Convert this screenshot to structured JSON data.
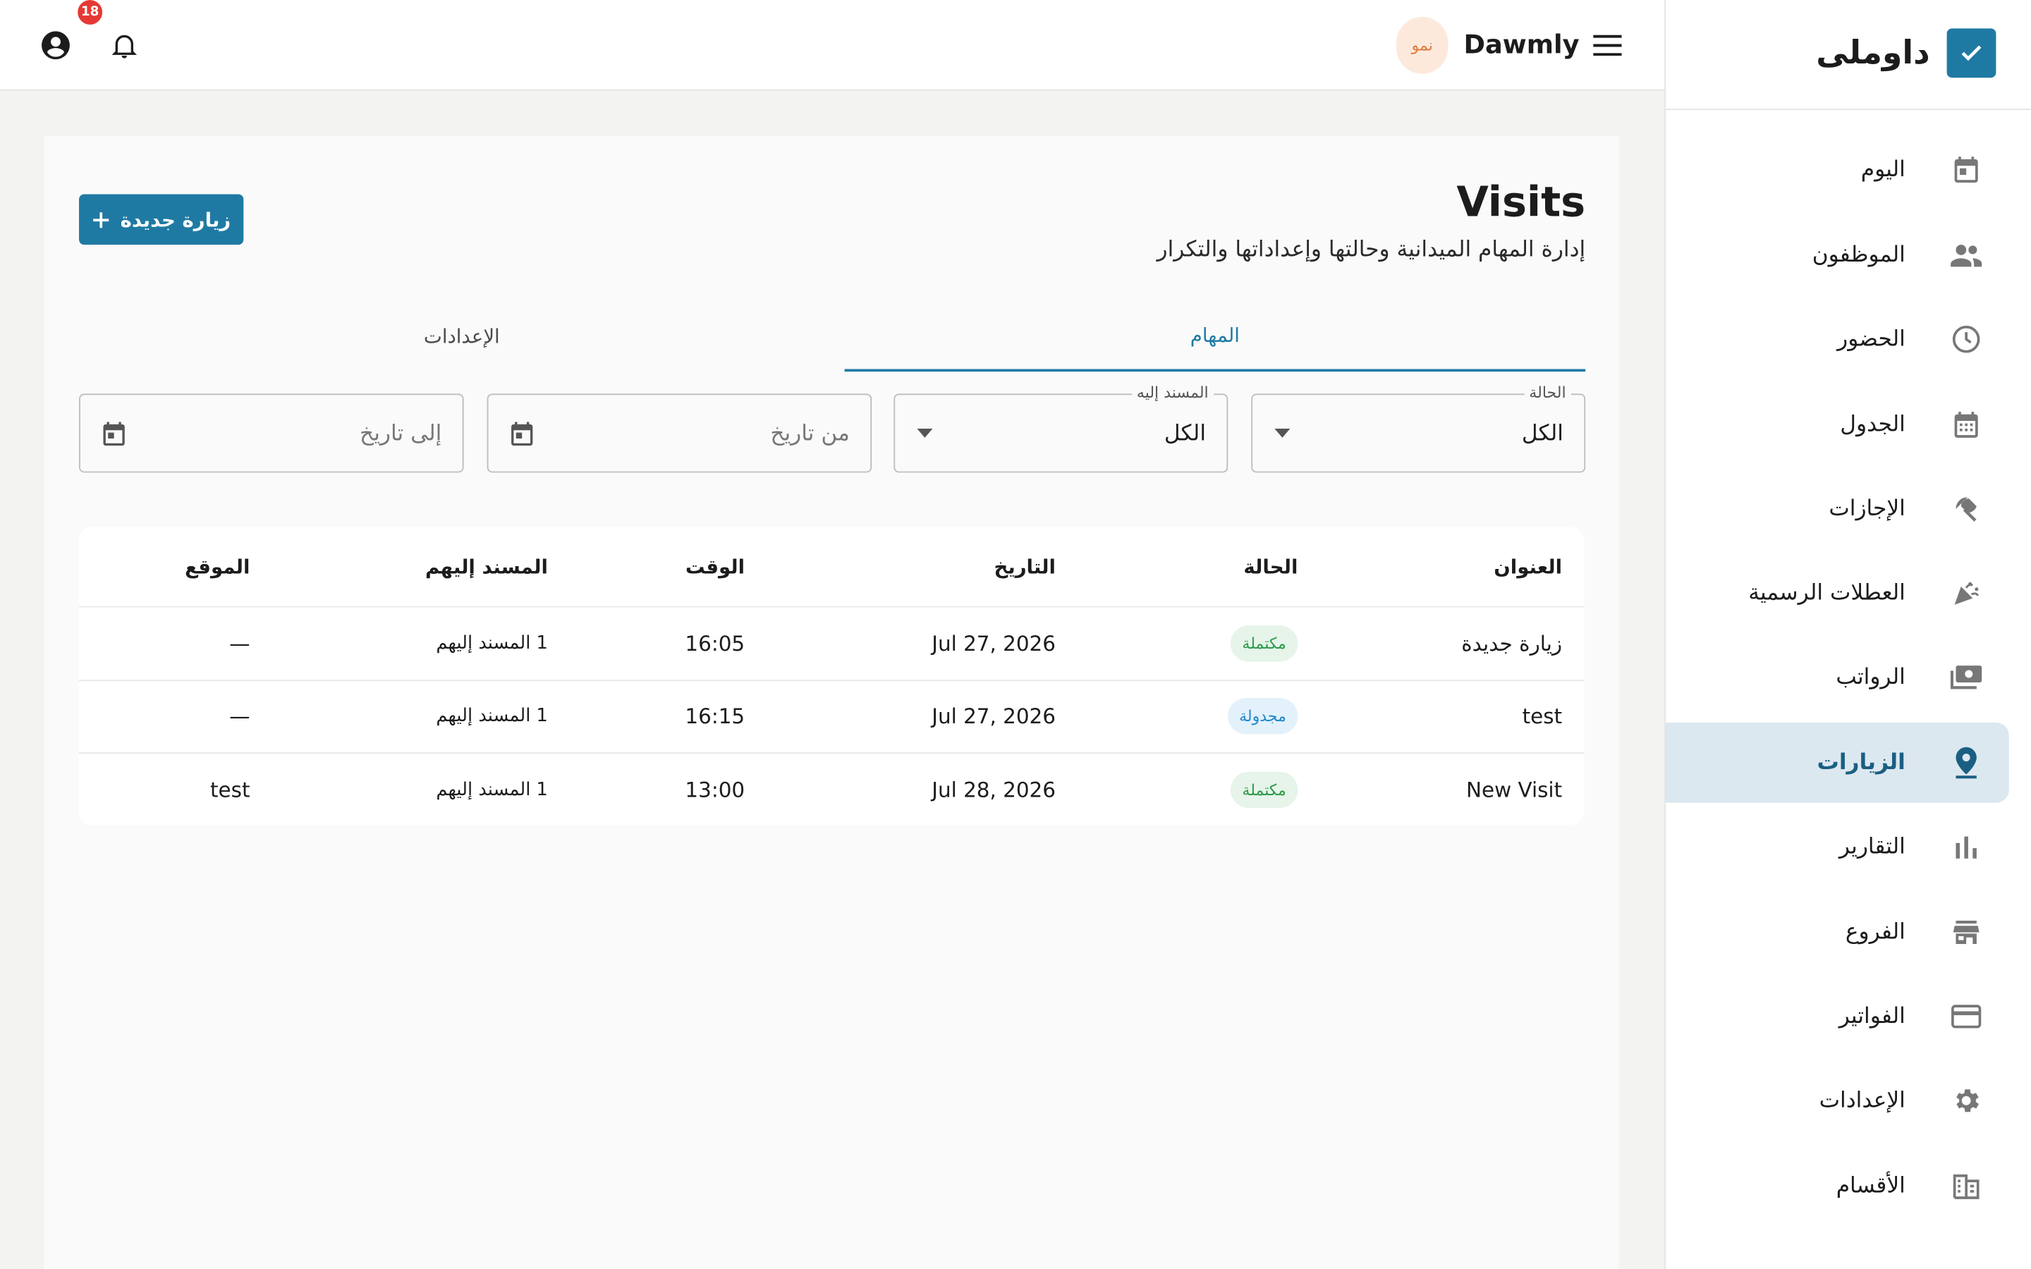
{
  "topbar": {
    "notification_count": "18",
    "brand_name": "Dawmly",
    "brand_chip": "نمو"
  },
  "sidebar": {
    "logo_text": "داوملى",
    "items": [
      {
        "label": "اليوم",
        "icon": "calendar-today-icon"
      },
      {
        "label": "الموظفون",
        "icon": "people-icon"
      },
      {
        "label": "الحضور",
        "icon": "clock-icon"
      },
      {
        "label": "الجدول",
        "icon": "calendar-grid-icon"
      },
      {
        "label": "الإجازات",
        "icon": "beach-umbrella-icon"
      },
      {
        "label": "العطلات الرسمية",
        "icon": "celebration-icon"
      },
      {
        "label": "الرواتب",
        "icon": "payments-icon"
      },
      {
        "label": "الزيارات",
        "icon": "location-pin-icon",
        "active": true
      },
      {
        "label": "التقارير",
        "icon": "bar-chart-icon"
      },
      {
        "label": "الفروع",
        "icon": "store-icon"
      },
      {
        "label": "الفواتير",
        "icon": "credit-card-icon"
      },
      {
        "label": "الإعدادات",
        "icon": "gear-icon"
      },
      {
        "label": "الأقسام",
        "icon": "building-icon"
      }
    ]
  },
  "main": {
    "title": "Visits",
    "subtitle": "إدارة المهام الميدانية وحالتها وإعداداتها والتكرار",
    "new_button_label": "زيارة جديدة",
    "tabs": [
      {
        "label": "المهام",
        "active": true
      },
      {
        "label": "الإعدادات",
        "active": false
      }
    ],
    "filters": {
      "status": {
        "label": "الحالة",
        "value": "الكل"
      },
      "assignee": {
        "label": "المسند إليه",
        "value": "الكل"
      },
      "from_date": {
        "placeholder": "من تاريخ"
      },
      "to_date": {
        "placeholder": "إلى تاريخ"
      }
    },
    "table": {
      "headers": {
        "title": "العنوان",
        "status": "الحالة",
        "date": "التاريخ",
        "time": "الوقت",
        "assignees": "المسند إليهم",
        "location": "الموقع"
      },
      "rows": [
        {
          "title": "زيارة جديدة",
          "status": "مكتملة",
          "status_type": "completed",
          "date": "Jul 27, 2026",
          "time": "16:05",
          "assignees": "1 المسند إليهم",
          "location": "—"
        },
        {
          "title": "test",
          "status": "مجدولة",
          "status_type": "scheduled",
          "date": "Jul 27, 2026",
          "time": "16:15",
          "assignees": "1 المسند إليهم",
          "location": "—"
        },
        {
          "title": "New Visit",
          "status": "مكتملة",
          "status_type": "completed",
          "date": "Jul 28, 2026",
          "time": "13:00",
          "assignees": "1 المسند إليهم",
          "location": "test"
        }
      ]
    }
  },
  "colors": {
    "primary": "#1f7aa3",
    "completed_bg": "#e6f4ea",
    "completed_text": "#2e9a4a",
    "scheduled_bg": "#e3f1fb",
    "scheduled_text": "#1f88c9",
    "active_nav_bg": "#dce8f0"
  }
}
